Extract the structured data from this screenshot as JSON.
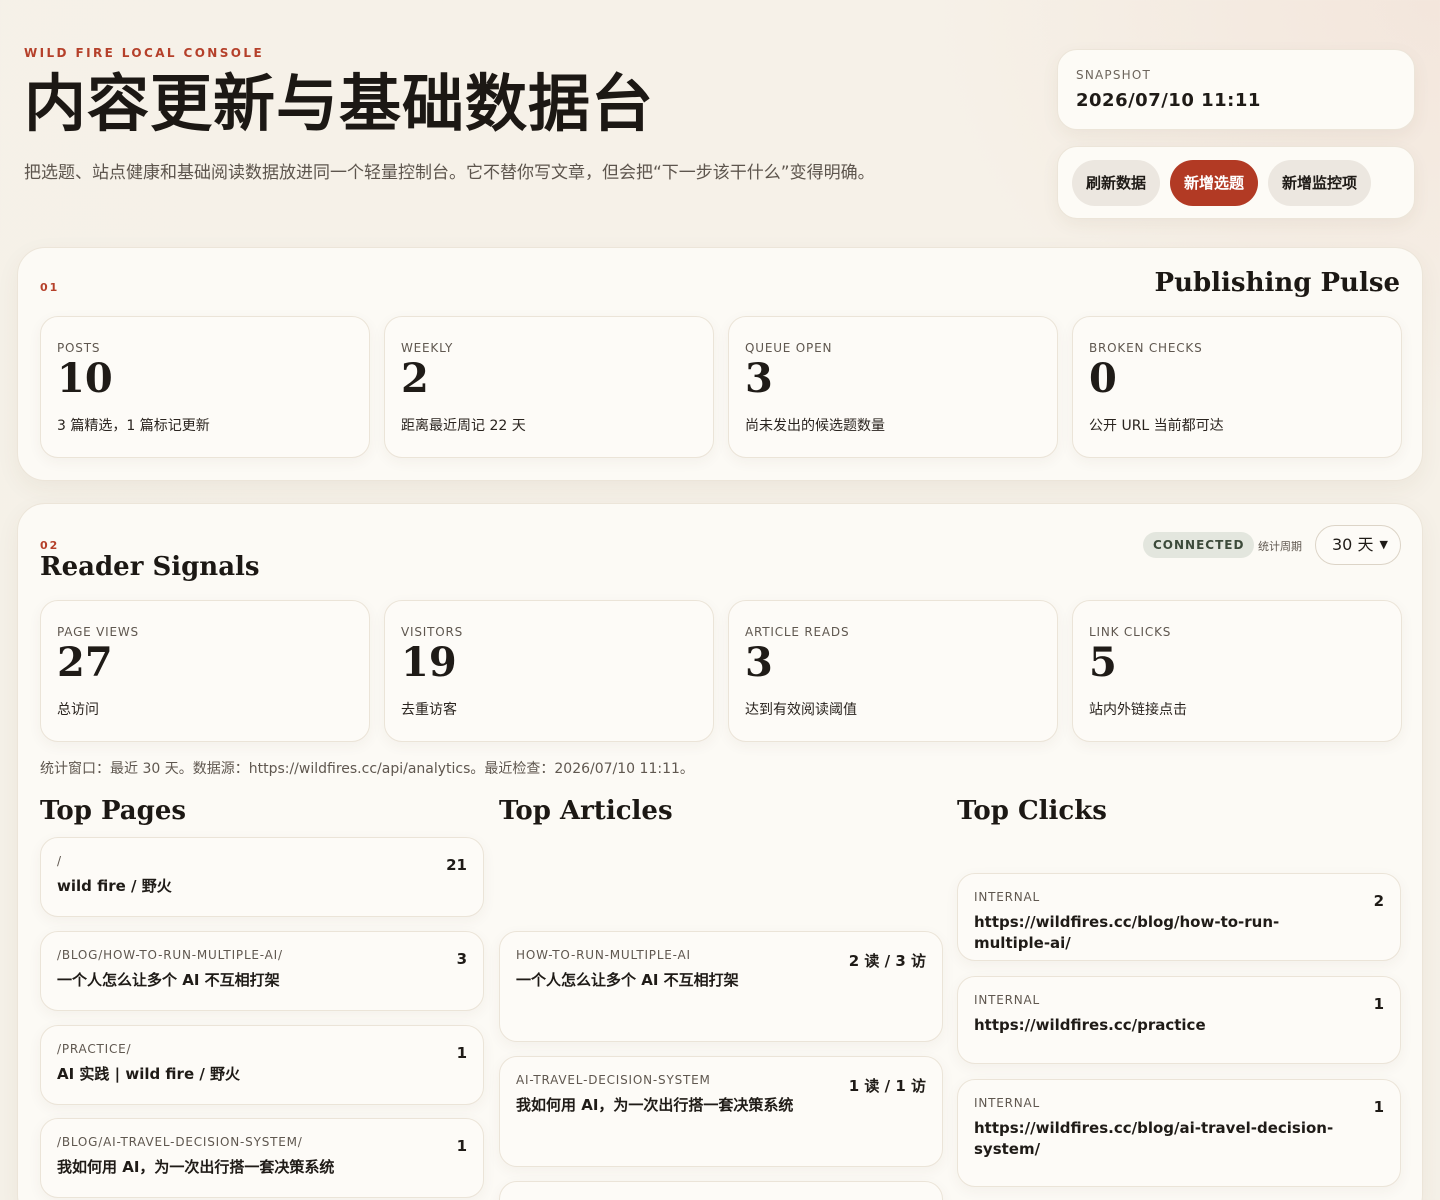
{
  "header": {
    "eyebrow": "WILD FIRE LOCAL CONSOLE",
    "title": "内容更新与基础数据台",
    "description": "把选题、站点健康和基础阅读数据放进同一个轻量控制台。它不替你写文章，但会把“下一步该干什么”变得明确。"
  },
  "snapshot": {
    "label": "SNAPSHOT",
    "value": "2026/07/10 11:11"
  },
  "actions": {
    "refresh": "刷新数据",
    "new_topic": "新增选题",
    "new_monitor": "新增监控项"
  },
  "pulse": {
    "number": "01",
    "title": "Publishing Pulse",
    "stats": [
      {
        "key": "POSTS",
        "value": "10",
        "desc": "3 篇精选，1 篇标记更新"
      },
      {
        "key": "WEEKLY",
        "value": "2",
        "desc": "距离最近周记 22 天"
      },
      {
        "key": "QUEUE OPEN",
        "value": "3",
        "desc": "尚未发出的候选题数量"
      },
      {
        "key": "BROKEN CHECKS",
        "value": "0",
        "desc": "公开 URL 当前都可达"
      }
    ]
  },
  "reader": {
    "number": "02",
    "title": "Reader Signals",
    "status": "CONNECTED",
    "period_label": "统计周期",
    "period_value": "30 天",
    "stats": [
      {
        "key": "PAGE VIEWS",
        "value": "27",
        "desc": "总访问"
      },
      {
        "key": "VISITORS",
        "value": "19",
        "desc": "去重访客"
      },
      {
        "key": "ARTICLE READS",
        "value": "3",
        "desc": "达到有效阅读阈值"
      },
      {
        "key": "LINK CLICKS",
        "value": "5",
        "desc": "站内外链接点击"
      }
    ],
    "note": "统计窗口：最近 30 天。数据源：https://wildfires.cc/api/analytics。最近检查：2026/07/10 11:11。",
    "top_pages": {
      "title": "Top Pages",
      "items": [
        {
          "key": "/",
          "title": "wild fire / 野火",
          "count": "21"
        },
        {
          "key": "/BLOG/HOW-TO-RUN-MULTIPLE-AI/",
          "title": "一个人怎么让多个 AI 不互相打架",
          "count": "3"
        },
        {
          "key": "/PRACTICE/",
          "title": "AI 实践 | wild fire / 野火",
          "count": "1"
        },
        {
          "key": "/BLOG/AI-TRAVEL-DECISION-SYSTEM/",
          "title": "我如何用 AI，为一次出行搭一套决策系统",
          "count": "1"
        }
      ]
    },
    "top_articles": {
      "title": "Top Articles",
      "items": [
        {
          "key": "HOW-TO-RUN-MULTIPLE-AI",
          "title": "一个人怎么让多个 AI 不互相打架",
          "count": "2 读 / 3 访"
        },
        {
          "key": "AI-TRAVEL-DECISION-SYSTEM",
          "title": "我如何用 AI，为一次出行搭一套决策系统",
          "count": "1 读 / 1 访"
        }
      ]
    },
    "top_clicks": {
      "title": "Top Clicks",
      "items": [
        {
          "key": "INTERNAL",
          "title": "https://wildfires.cc/blog/how-to-run-multiple-ai/",
          "count": "2"
        },
        {
          "key": "INTERNAL",
          "title": "https://wildfires.cc/practice",
          "count": "1"
        },
        {
          "key": "INTERNAL",
          "title": "https://wildfires.cc/blog/ai-travel-decision-system/",
          "count": "1"
        }
      ]
    }
  },
  "colors": {
    "accent": "#b23a24",
    "background": "#f5f1e8",
    "card": "#fdfbf7",
    "badge": "#e3e6de"
  }
}
